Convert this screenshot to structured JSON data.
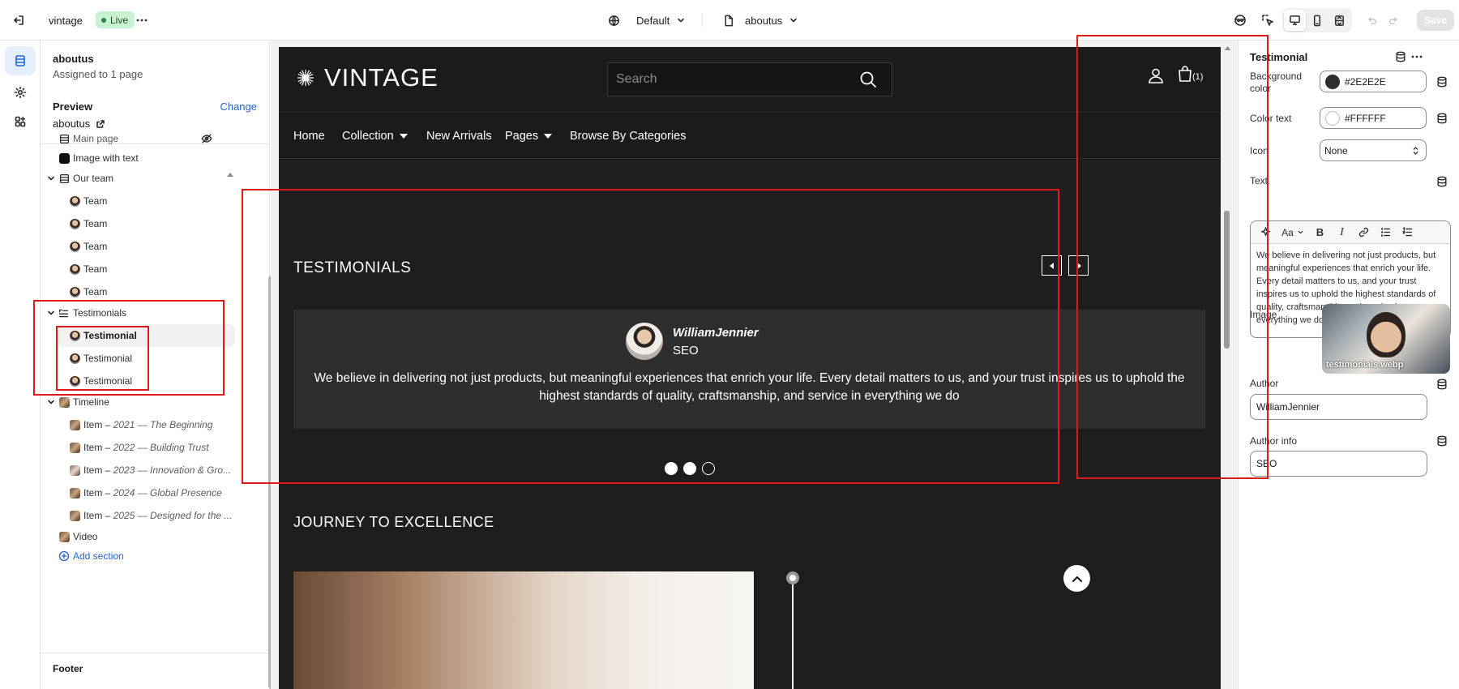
{
  "topbar": {
    "store_name": "vintage",
    "status_badge": "Live",
    "theme_selector": "Default",
    "page_selector": "aboutus",
    "save_label": "Save"
  },
  "left_panel": {
    "title": "aboutus",
    "subtitle": "Assigned to 1 page",
    "preview_label": "Preview",
    "change_label": "Change",
    "preview_value": "aboutus",
    "tree": {
      "main_page": "Main page",
      "image_with_text": "Image with text",
      "our_team": "Our team",
      "team_items": [
        "Team",
        "Team",
        "Team",
        "Team",
        "Team"
      ],
      "testimonials": "Testimonials",
      "testimonial_items": [
        "Testimonial",
        "Testimonial",
        "Testimonial"
      ],
      "timeline": "Timeline",
      "timeline_items": [
        {
          "prefix": "Item – ",
          "title": "2021 — The Beginning"
        },
        {
          "prefix": "Item – ",
          "title": "2022 — Building Trust"
        },
        {
          "prefix": "Item – ",
          "title": "2023 — Innovation & Gro..."
        },
        {
          "prefix": "Item – ",
          "title": "2024 — Global Presence"
        },
        {
          "prefix": "Item – ",
          "title": "2025 — Designed for the ..."
        }
      ],
      "video": "Video",
      "add_section": "Add section"
    },
    "footer": "Footer"
  },
  "site": {
    "logo": "VINTAGE",
    "search_placeholder": "Search",
    "cart_count": "(1)",
    "nav": [
      "Home",
      "Collection",
      "New Arrivals",
      "Pages",
      "Browse By Categories"
    ],
    "testimonials_title": "TESTIMONIALS",
    "author": "WilliamJennier",
    "author_info": "SEO",
    "quote": "We believe in delivering not just products, but meaningful experiences that enrich your life. Every detail matters to us, and your trust inspires us to uphold the highest standards of quality, craftsmanship, and service in everything we do",
    "journey_title": "JOURNEY TO EXCELLENCE"
  },
  "right_panel": {
    "title": "Testimonial",
    "bg_color_label": "Background color",
    "bg_color_value": "#2E2E2E",
    "text_color_label": "Color text",
    "text_color_value": "#FFFFFF",
    "icon_label": "Icon",
    "icon_value": "None",
    "text_label": "Text",
    "text_value": "We believe in delivering not just products, but meaningful experiences that enrich your life. Every detail matters to us, and your trust inspires us to uphold the highest standards of quality, craftsmanship, and service in everything we do",
    "image_label": "Image",
    "image_filename": "testimonials.webp",
    "author_label": "Author",
    "author_value": "WilliamJennier",
    "author_info_label": "Author info",
    "author_info_value": "SEO",
    "rte_font_label": "Aa"
  },
  "colors": {
    "accent": "#2463d1",
    "highlight": "#e01a1a",
    "live_badge_bg": "#c9f2d1",
    "canvas_bg": "#1e1e1e",
    "card_bg": "#2e2e2e"
  }
}
